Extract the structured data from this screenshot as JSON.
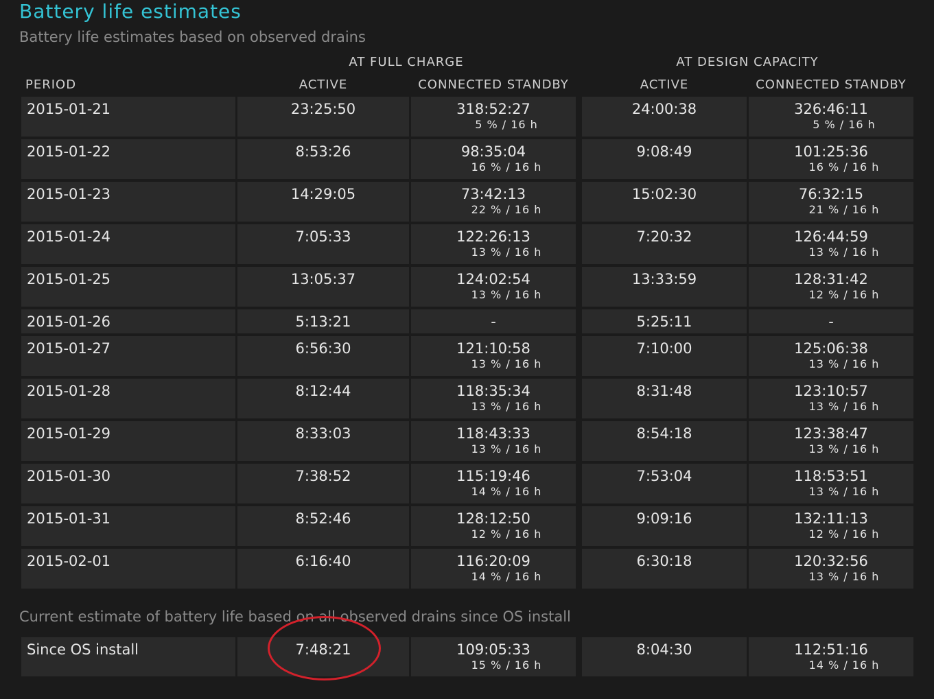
{
  "title": "Battery life estimates",
  "subtitle": "Battery life estimates based on observed drains",
  "group_headers": {
    "full_charge": "AT FULL CHARGE",
    "design_capacity": "AT DESIGN CAPACITY"
  },
  "columns": {
    "period": "PERIOD",
    "fc_active": "ACTIVE",
    "fc_standby": "CONNECTED STANDBY",
    "dc_active": "ACTIVE",
    "dc_standby": "CONNECTED STANDBY"
  },
  "rows": [
    {
      "period": "2015-01-21",
      "fc_active": "23:25:50",
      "fc_standby": "318:52:27",
      "fc_standby_sub": "5 % / 16 h",
      "dc_active": "24:00:38",
      "dc_standby": "326:46:11",
      "dc_standby_sub": "5 % / 16 h"
    },
    {
      "period": "2015-01-22",
      "fc_active": "8:53:26",
      "fc_standby": "98:35:04",
      "fc_standby_sub": "16 % / 16 h",
      "dc_active": "9:08:49",
      "dc_standby": "101:25:36",
      "dc_standby_sub": "16 % / 16 h"
    },
    {
      "period": "2015-01-23",
      "fc_active": "14:29:05",
      "fc_standby": "73:42:13",
      "fc_standby_sub": "22 % / 16 h",
      "dc_active": "15:02:30",
      "dc_standby": "76:32:15",
      "dc_standby_sub": "21 % / 16 h"
    },
    {
      "period": "2015-01-24",
      "fc_active": "7:05:33",
      "fc_standby": "122:26:13",
      "fc_standby_sub": "13 % / 16 h",
      "dc_active": "7:20:32",
      "dc_standby": "126:44:59",
      "dc_standby_sub": "13 % / 16 h"
    },
    {
      "period": "2015-01-25",
      "fc_active": "13:05:37",
      "fc_standby": "124:02:54",
      "fc_standby_sub": "13 % / 16 h",
      "dc_active": "13:33:59",
      "dc_standby": "128:31:42",
      "dc_standby_sub": "12 % / 16 h"
    },
    {
      "period": "2015-01-26",
      "fc_active": "5:13:21",
      "fc_standby": "-",
      "fc_standby_sub": "",
      "dc_active": "5:25:11",
      "dc_standby": "-",
      "dc_standby_sub": ""
    },
    {
      "period": "2015-01-27",
      "fc_active": "6:56:30",
      "fc_standby": "121:10:58",
      "fc_standby_sub": "13 % / 16 h",
      "dc_active": "7:10:00",
      "dc_standby": "125:06:38",
      "dc_standby_sub": "13 % / 16 h"
    },
    {
      "period": "2015-01-28",
      "fc_active": "8:12:44",
      "fc_standby": "118:35:34",
      "fc_standby_sub": "13 % / 16 h",
      "dc_active": "8:31:48",
      "dc_standby": "123:10:57",
      "dc_standby_sub": "13 % / 16 h"
    },
    {
      "period": "2015-01-29",
      "fc_active": "8:33:03",
      "fc_standby": "118:43:33",
      "fc_standby_sub": "13 % / 16 h",
      "dc_active": "8:54:18",
      "dc_standby": "123:38:47",
      "dc_standby_sub": "13 % / 16 h"
    },
    {
      "period": "2015-01-30",
      "fc_active": "7:38:52",
      "fc_standby": "115:19:46",
      "fc_standby_sub": "14 % / 16 h",
      "dc_active": "7:53:04",
      "dc_standby": "118:53:51",
      "dc_standby_sub": "13 % / 16 h"
    },
    {
      "period": "2015-01-31",
      "fc_active": "8:52:46",
      "fc_standby": "128:12:50",
      "fc_standby_sub": "12 % / 16 h",
      "dc_active": "9:09:16",
      "dc_standby": "132:11:13",
      "dc_standby_sub": "12 % / 16 h"
    },
    {
      "period": "2015-02-01",
      "fc_active": "6:16:40",
      "fc_standby": "116:20:09",
      "fc_standby_sub": "14 % / 16 h",
      "dc_active": "6:30:18",
      "dc_standby": "120:32:56",
      "dc_standby_sub": "13 % / 16 h"
    }
  ],
  "since_install_caption": "Current estimate of battery life based on all observed drains since OS install",
  "since_install": {
    "period": "Since OS install",
    "fc_active": "7:48:21",
    "fc_standby": "109:05:33",
    "fc_standby_sub": "15 % / 16 h",
    "dc_active": "8:04:30",
    "dc_standby": "112:51:16",
    "dc_standby_sub": "14 % / 16 h"
  },
  "colors": {
    "title": "#34c3d4",
    "annotation_circle": "#d3212b",
    "cell_bg": "#2a2a2a",
    "page_bg": "#1b1b1b"
  }
}
